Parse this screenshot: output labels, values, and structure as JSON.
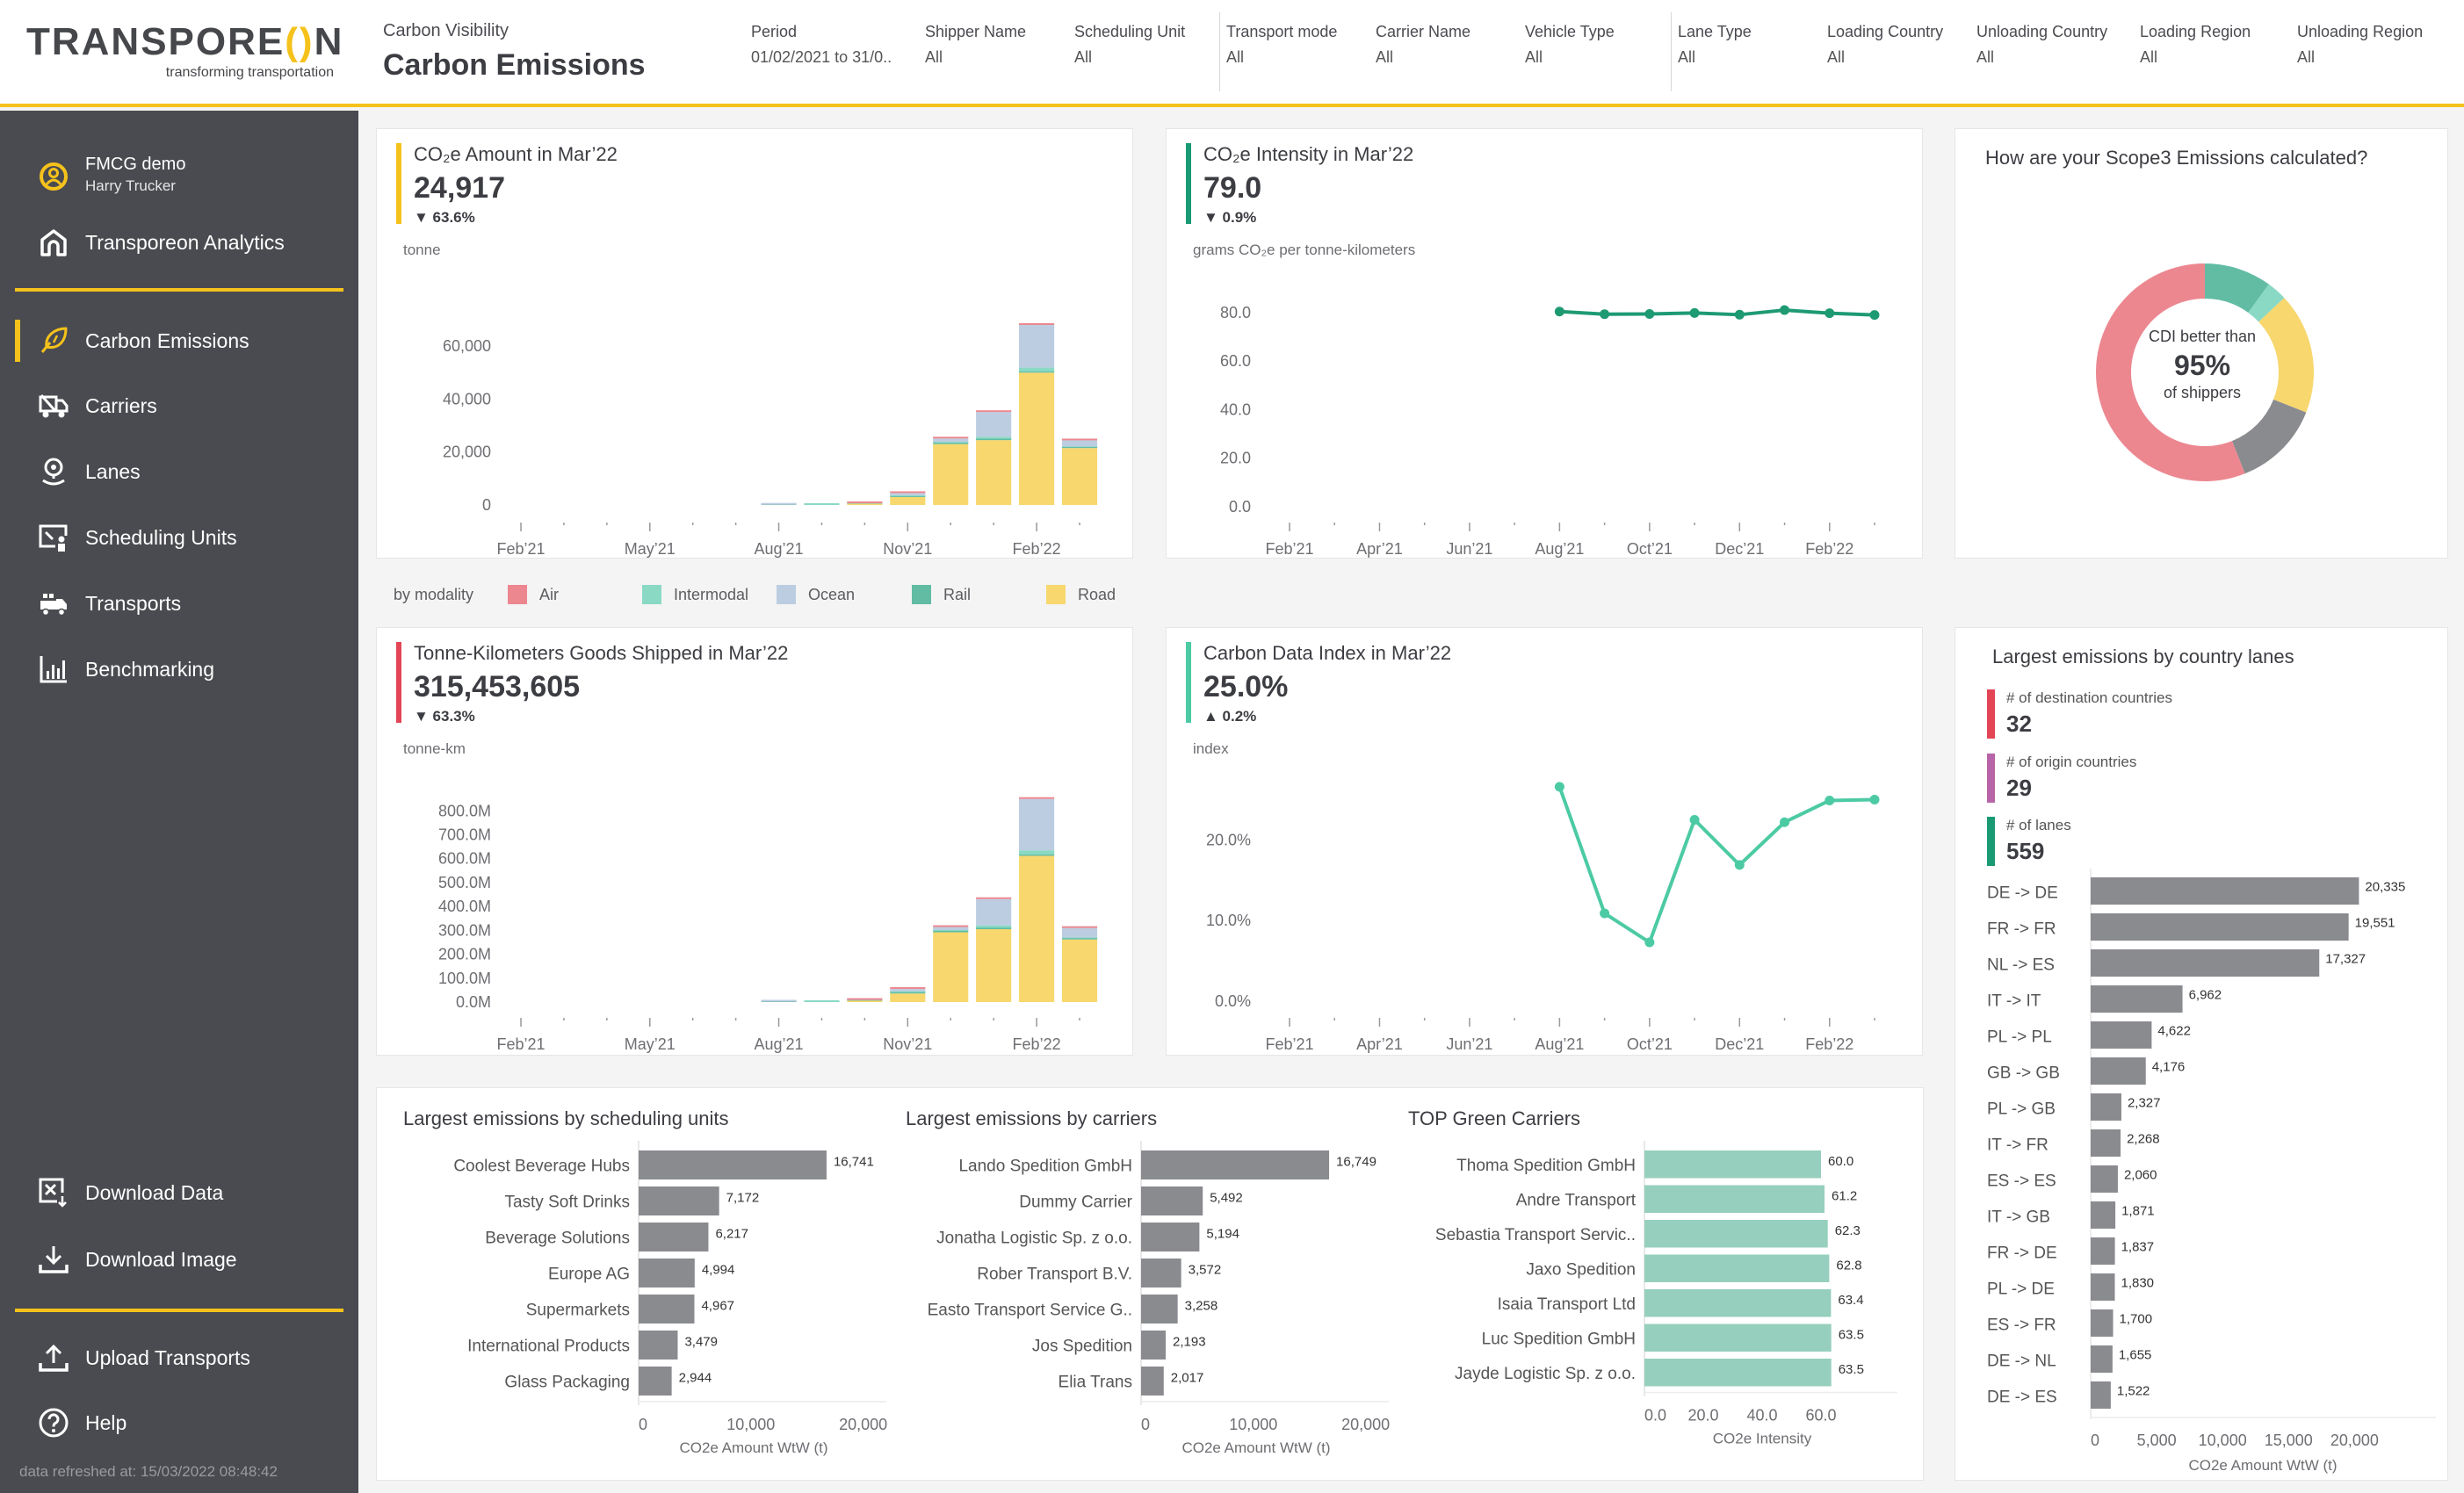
{
  "header": {
    "logo_text_a": "TRANSPORE",
    "logo_text_o": "()",
    "logo_text_b": "N",
    "logo_tagline": "transforming transportation",
    "subtitle": "Carbon Visibility",
    "title": "Carbon Emissions",
    "filters": [
      {
        "label": "Period",
        "value": "01/02/2021 to 31/0.."
      },
      {
        "label": "Shipper Name",
        "value": "All"
      },
      {
        "label": "Scheduling Unit",
        "value": "All"
      },
      {
        "label": "Transport mode",
        "value": "All"
      },
      {
        "label": "Carrier Name",
        "value": "All"
      },
      {
        "label": "Vehicle Type",
        "value": "All"
      },
      {
        "label": "Lane Type",
        "value": "All"
      },
      {
        "label": "Loading Country",
        "value": "All"
      },
      {
        "label": "Unloading Country",
        "value": "All"
      },
      {
        "label": "Loading Region",
        "value": "All"
      },
      {
        "label": "Unloading Region",
        "value": "All"
      }
    ]
  },
  "sidebar": {
    "user": {
      "account": "FMCG demo",
      "name": "Harry Trucker",
      "icon": "user-circle-icon"
    },
    "home": {
      "label": "Transporeon Analytics",
      "icon": "home-icon"
    },
    "items": [
      {
        "label": "Carbon Emissions",
        "icon": "leaf-icon",
        "active": true
      },
      {
        "label": "Carriers",
        "icon": "truck-icon"
      },
      {
        "label": "Lanes",
        "icon": "location-pin-icon"
      },
      {
        "label": "Scheduling Units",
        "icon": "presentation-icon"
      },
      {
        "label": "Transports",
        "icon": "transport-icon"
      },
      {
        "label": "Benchmarking",
        "icon": "bar-chart-icon"
      }
    ],
    "actions": [
      {
        "label": "Download Data",
        "icon": "download-data-icon"
      },
      {
        "label": "Download Image",
        "icon": "download-icon"
      }
    ],
    "bottom": [
      {
        "label": "Upload Transports",
        "icon": "upload-icon"
      },
      {
        "label": "Help",
        "icon": "help-icon"
      }
    ],
    "refreshed": "data refreshed at: 15/03/2022 08:48:42"
  },
  "colors": {
    "accent": "#f5c21b",
    "sidebar": "#4a4b50",
    "air": "#ec8790",
    "intermodal": "#8ad9c5",
    "ocean": "#bccde1",
    "rail": "#62bca4",
    "road": "#f7d76e",
    "gray_bar": "#8a8b8f",
    "green_bar": "#96cfbd",
    "line_green": "#1e9a73",
    "line_teal": "#4ccaa3",
    "kpi_red": "#e34557",
    "kpi_purple": "#b864a8",
    "kpi_green": "#1a9a73"
  },
  "legend": {
    "title": "by modality",
    "items": [
      {
        "label": "Air",
        "key": "air"
      },
      {
        "label": "Intermodal",
        "key": "intermodal"
      },
      {
        "label": "Ocean",
        "key": "ocean"
      },
      {
        "label": "Rail",
        "key": "rail"
      },
      {
        "label": "Road",
        "key": "road"
      }
    ]
  },
  "kpis": {
    "co2": {
      "title": "CO₂e Amount in Mar’22",
      "value": "24,917",
      "delta": "▼ 63.6%",
      "unit": "tonne"
    },
    "intensity": {
      "title": "CO₂e Intensity in Mar’22",
      "value": "79.0",
      "delta": "▼ 0.9%",
      "unit": "grams CO₂e per tonne-kilometers"
    },
    "tkm": {
      "title": "Tonne-Kilometers Goods Shipped in Mar’22",
      "value": "315,453,605",
      "delta": "▼ 63.3%",
      "unit": "tonne-km"
    },
    "cdi": {
      "title": "Carbon Data Index in Mar’22",
      "value": "25.0%",
      "delta": "▲ 0.2%",
      "unit": "index"
    }
  },
  "scope3": {
    "title": "How are your Scope3 Emissions calculated?",
    "center_top": "CDI better than",
    "center_value": "95%",
    "center_bottom": "of shippers"
  },
  "lanes_panel": {
    "title": "Largest emissions by country lanes",
    "stats": [
      {
        "label": "# of destination countries",
        "value": "32",
        "color": "#e34557"
      },
      {
        "label": "# of origin countries",
        "value": "29",
        "color": "#b864a8"
      },
      {
        "label": "# of lanes",
        "value": "559",
        "color": "#1a9a73"
      }
    ]
  },
  "chart_data": [
    {
      "id": "co2_amount",
      "type": "bar",
      "stacked": true,
      "title": "CO₂e Amount in Mar’22",
      "ylabel": "tonne",
      "ylim": [
        0,
        70000
      ],
      "yticks": [
        0,
        20000,
        40000,
        60000
      ],
      "ytick_labels": [
        "0",
        "20,000",
        "40,000",
        "60,000"
      ],
      "months": [
        "Feb'21",
        "Mar'21",
        "Apr'21",
        "May'21",
        "Jun'21",
        "Jul'21",
        "Aug'21",
        "Sep'21",
        "Oct'21",
        "Nov'21",
        "Dec'21",
        "Jan'22",
        "Feb'22",
        "Mar'22"
      ],
      "xtick_labels": [
        {
          "i": 0,
          "label": "Feb’21"
        },
        {
          "i": 3,
          "label": "May’21"
        },
        {
          "i": 6,
          "label": "Aug’21"
        },
        {
          "i": 9,
          "label": "Nov’21"
        },
        {
          "i": 12,
          "label": "Feb’22"
        }
      ],
      "series": [
        {
          "name": "Road",
          "key": "road",
          "values": [
            0,
            0,
            0,
            0,
            0,
            0,
            0,
            0,
            500,
            3000,
            23000,
            24500,
            50000,
            21500
          ]
        },
        {
          "name": "Rail",
          "key": "rail",
          "values": [
            0,
            0,
            0,
            0,
            0,
            0,
            100,
            0,
            100,
            300,
            500,
            500,
            400,
            400
          ]
        },
        {
          "name": "Intermodal",
          "key": "intermodal",
          "values": [
            0,
            0,
            0,
            0,
            0,
            0,
            0,
            200,
            0,
            300,
            300,
            800,
            1500,
            200
          ]
        },
        {
          "name": "Ocean",
          "key": "ocean",
          "values": [
            0,
            0,
            0,
            0,
            0,
            0,
            100,
            0,
            100,
            900,
            1300,
            9300,
            16100,
            2300
          ]
        },
        {
          "name": "Air",
          "key": "air",
          "values": [
            0,
            0,
            0,
            0,
            0,
            0,
            0,
            0,
            300,
            500,
            400,
            400,
            500,
            517
          ]
        }
      ]
    },
    {
      "id": "co2_intensity",
      "type": "line",
      "title": "CO₂e Intensity in Mar’22",
      "ylabel": "grams CO₂e per tonne-kilometers",
      "ylim": [
        0,
        85
      ],
      "yticks": [
        0,
        20,
        40,
        60,
        80
      ],
      "ytick_labels": [
        "0.0",
        "20.0",
        "40.0",
        "60.0",
        "80.0"
      ],
      "months": [
        "Feb'21",
        "Mar'21",
        "Apr'21",
        "May'21",
        "Jun'21",
        "Jul'21",
        "Aug'21",
        "Sep'21",
        "Oct'21",
        "Nov'21",
        "Dec'21",
        "Jan'22",
        "Feb'22",
        "Mar'22"
      ],
      "xtick_labels": [
        {
          "i": 0,
          "label": "Feb’21"
        },
        {
          "i": 2,
          "label": "Apr’21"
        },
        {
          "i": 4,
          "label": "Jun’21"
        },
        {
          "i": 6,
          "label": "Aug’21"
        },
        {
          "i": 8,
          "label": "Oct’21"
        },
        {
          "i": 10,
          "label": "Dec’21"
        },
        {
          "i": 12,
          "label": "Feb’22"
        }
      ],
      "values": [
        null,
        null,
        null,
        null,
        null,
        null,
        80.4,
        79.3,
        79.4,
        79.8,
        79.1,
        81.0,
        79.7,
        79.0
      ]
    },
    {
      "id": "tonne_km",
      "type": "bar",
      "stacked": true,
      "title": "Tonne-Kilometers Goods Shipped in Mar’22",
      "ylabel": "tonne-km",
      "ylim": [
        0,
        860
      ],
      "yticks": [
        0,
        100,
        200,
        300,
        400,
        500,
        600,
        700,
        800
      ],
      "ytick_labels": [
        "0.0M",
        "100.0M",
        "200.0M",
        "300.0M",
        "400.0M",
        "500.0M",
        "600.0M",
        "700.0M",
        "800.0M"
      ],
      "months": [
        "Feb'21",
        "Mar'21",
        "Apr'21",
        "May'21",
        "Jun'21",
        "Jul'21",
        "Aug'21",
        "Sep'21",
        "Oct'21",
        "Nov'21",
        "Dec'21",
        "Jan'22",
        "Feb'22",
        "Mar'22"
      ],
      "xtick_labels": [
        {
          "i": 0,
          "label": "Feb’21"
        },
        {
          "i": 3,
          "label": "May’21"
        },
        {
          "i": 6,
          "label": "Aug’21"
        },
        {
          "i": 9,
          "label": "Nov’21"
        },
        {
          "i": 12,
          "label": "Feb’22"
        }
      ],
      "series": [
        {
          "name": "Road",
          "key": "road",
          "values": [
            0,
            0,
            0,
            0,
            0,
            0,
            0,
            0,
            6,
            36,
            292,
            305,
            612,
            262
          ]
        },
        {
          "name": "Rail",
          "key": "rail",
          "values": [
            0,
            0,
            0,
            0,
            0,
            0,
            2,
            0,
            2,
            5,
            6,
            6,
            5,
            5
          ]
        },
        {
          "name": "Intermodal",
          "key": "intermodal",
          "values": [
            0,
            0,
            0,
            0,
            0,
            0,
            0,
            3,
            0,
            4,
            4,
            10,
            18,
            3
          ]
        },
        {
          "name": "Ocean",
          "key": "ocean",
          "values": [
            0,
            0,
            0,
            0,
            0,
            0,
            1,
            0,
            1,
            10,
            12,
            110,
            215,
            40
          ]
        },
        {
          "name": "Air",
          "key": "air",
          "values": [
            0,
            0,
            0,
            0,
            0,
            0,
            0,
            0,
            4,
            5,
            5,
            5,
            5,
            5.5
          ]
        }
      ]
    },
    {
      "id": "carbon_data_index",
      "type": "line",
      "title": "Carbon Data Index in Mar’22",
      "ylabel": "index",
      "ylim": [
        0,
        28
      ],
      "yticks": [
        0,
        10,
        20
      ],
      "ytick_labels": [
        "0.0%",
        "10.0%",
        "20.0%"
      ],
      "months": [
        "Feb'21",
        "Mar'21",
        "Apr'21",
        "May'21",
        "Jun'21",
        "Jul'21",
        "Aug'21",
        "Sep'21",
        "Oct'21",
        "Nov'21",
        "Dec'21",
        "Jan'22",
        "Feb'22",
        "Mar'22"
      ],
      "xtick_labels": [
        {
          "i": 0,
          "label": "Feb’21"
        },
        {
          "i": 2,
          "label": "Apr’21"
        },
        {
          "i": 4,
          "label": "Jun’21"
        },
        {
          "i": 6,
          "label": "Aug’21"
        },
        {
          "i": 8,
          "label": "Oct’21"
        },
        {
          "i": 10,
          "label": "Dec’21"
        },
        {
          "i": 12,
          "label": "Feb’22"
        }
      ],
      "values": [
        null,
        null,
        null,
        null,
        null,
        null,
        26.6,
        10.9,
        7.3,
        22.5,
        16.9,
        22.2,
        24.9,
        25.0
      ]
    },
    {
      "id": "scope3_donut",
      "type": "pie",
      "donut": true,
      "title": "How are your Scope3 Emissions calculated?",
      "slices": [
        {
          "color_key": "rail",
          "value": 10
        },
        {
          "color_key": "intermodal",
          "value": 3
        },
        {
          "color_key": "road",
          "value": 18
        },
        {
          "color_key": "gray_bar",
          "value": 13
        },
        {
          "color_key": "air",
          "value": 56
        }
      ]
    },
    {
      "id": "scheduling_units",
      "type": "bar",
      "orientation": "horizontal",
      "title": "Largest emissions by scheduling units",
      "xlabel": "CO2e Amount WtW (t)",
      "xlim": [
        0,
        20500
      ],
      "xticks": [
        0,
        10000,
        20000
      ],
      "xtick_labels": [
        "0",
        "10,000",
        "20,000"
      ],
      "categories": [
        "Coolest Beverage Hubs",
        "Tasty Soft Drinks",
        "Beverage Solutions",
        "Europe AG",
        "Supermarkets",
        "International Products",
        "Glass Packaging"
      ],
      "values": [
        16741,
        7172,
        6217,
        4994,
        4967,
        3479,
        2944
      ],
      "value_labels": [
        "16,741",
        "7,172",
        "6,217",
        "4,994",
        "4,967",
        "3,479",
        "2,944"
      ]
    },
    {
      "id": "carriers",
      "type": "bar",
      "orientation": "horizontal",
      "title": "Largest emissions by carriers",
      "xlabel": "CO2e Amount WtW (t)",
      "xlim": [
        0,
        20500
      ],
      "xticks": [
        0,
        10000,
        20000
      ],
      "xtick_labels": [
        "0",
        "10,000",
        "20,000"
      ],
      "categories": [
        "Lando Spedition GmbH",
        "Dummy Carrier",
        "Jonatha Logistic Sp. z o.o.",
        "Rober Transport B.V.",
        "Easto Transport Service G..",
        "Jos Spedition",
        "Elia Trans"
      ],
      "values": [
        16749,
        5492,
        5194,
        3572,
        3258,
        2193,
        2017
      ],
      "value_labels": [
        "16,749",
        "5,492",
        "5,194",
        "3,572",
        "3,258",
        "2,193",
        "2,017"
      ]
    },
    {
      "id": "green_carriers",
      "type": "bar",
      "orientation": "horizontal",
      "title": "TOP Green Carriers",
      "xlabel": "CO2e Intensity",
      "xlim": [
        0,
        80
      ],
      "xticks": [
        0,
        20,
        40,
        60
      ],
      "xtick_labels": [
        "0.0",
        "20.0",
        "40.0",
        "60.0"
      ],
      "categories": [
        "Thoma Spedition GmbH",
        "Andre Transport",
        "Sebastia Transport Servic..",
        "Jaxo Spedition",
        "Isaia Transport Ltd",
        "Luc Spedition GmbH",
        "Jayde Logistic Sp. z o.o."
      ],
      "values": [
        60.0,
        61.2,
        62.3,
        62.8,
        63.4,
        63.5,
        63.5
      ],
      "value_labels": [
        "60.0",
        "61.2",
        "62.3",
        "62.8",
        "63.4",
        "63.5",
        "63.5"
      ]
    },
    {
      "id": "country_lanes",
      "type": "bar",
      "orientation": "horizontal",
      "title": "Largest emissions by country lanes",
      "xlabel": "CO2e Amount WtW (t)",
      "xlim": [
        0,
        25500
      ],
      "xticks": [
        0,
        5000,
        10000,
        15000,
        20000
      ],
      "xtick_labels": [
        "0",
        "5,000",
        "10,000",
        "15,000",
        "20,000"
      ],
      "categories": [
        "DE -> DE",
        "FR -> FR",
        "NL -> ES",
        "IT -> IT",
        "PL -> PL",
        "GB -> GB",
        "PL -> GB",
        "IT -> FR",
        "ES -> ES",
        "IT -> GB",
        "FR -> DE",
        "PL -> DE",
        "ES -> FR",
        "DE -> NL",
        "DE -> ES"
      ],
      "values": [
        20335,
        19551,
        17327,
        6962,
        4622,
        4176,
        2327,
        2268,
        2060,
        1871,
        1837,
        1830,
        1700,
        1655,
        1522
      ],
      "value_labels": [
        "20,335",
        "19,551",
        "17,327",
        "6,962",
        "4,622",
        "4,176",
        "2,327",
        "2,268",
        "2,060",
        "1,871",
        "1,837",
        "1,830",
        "1,700",
        "1,655",
        "1,522"
      ]
    }
  ]
}
